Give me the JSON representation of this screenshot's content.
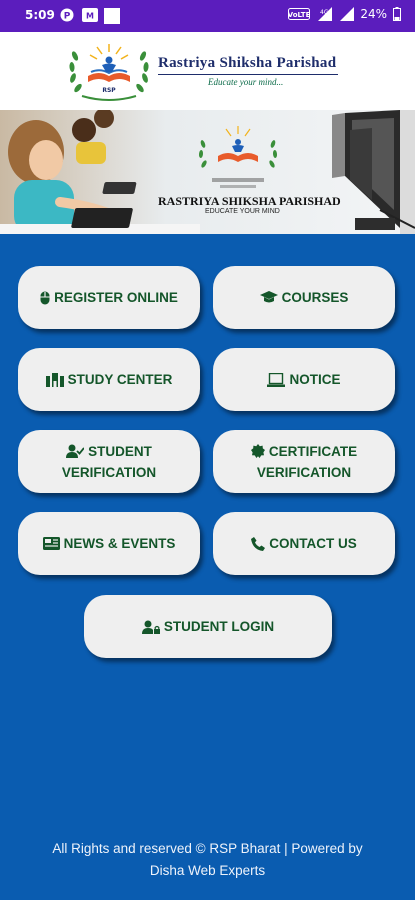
{
  "status_bar": {
    "time": "5:09",
    "signal_label": "VoLTE",
    "battery": "24%"
  },
  "header": {
    "org_name": "Rastriya Shiksha Parishad",
    "tagline": "Educate your mind...",
    "logo_badge": "RSP"
  },
  "banner": {
    "title": "RASTRIYA SHIKSHA PARISHAD",
    "tagline": "EDUCATE YOUR MIND"
  },
  "menu": {
    "register_online": "REGISTER ONLINE",
    "courses": "COURSES",
    "study_center": "STUDY CENTER",
    "notice": "NOTICE",
    "student_verification_1": "STUDENT",
    "student_verification_2": "VERIFICATION",
    "certificate_verification_1": "CERTIFICATE",
    "certificate_verification_2": "VERIFICATION",
    "news_events": "NEWS & EVENTS",
    "contact_us": "CONTACT US",
    "student_login": "STUDENT LOGIN"
  },
  "footer": {
    "line1": "All Rights and reserved © RSP Bharat | Powered by",
    "line2": "Disha Web Experts"
  },
  "colors": {
    "status_bar": "#5b1dbd",
    "background": "#0a5cb0",
    "button": "#efefef",
    "button_text": "#14562a"
  }
}
